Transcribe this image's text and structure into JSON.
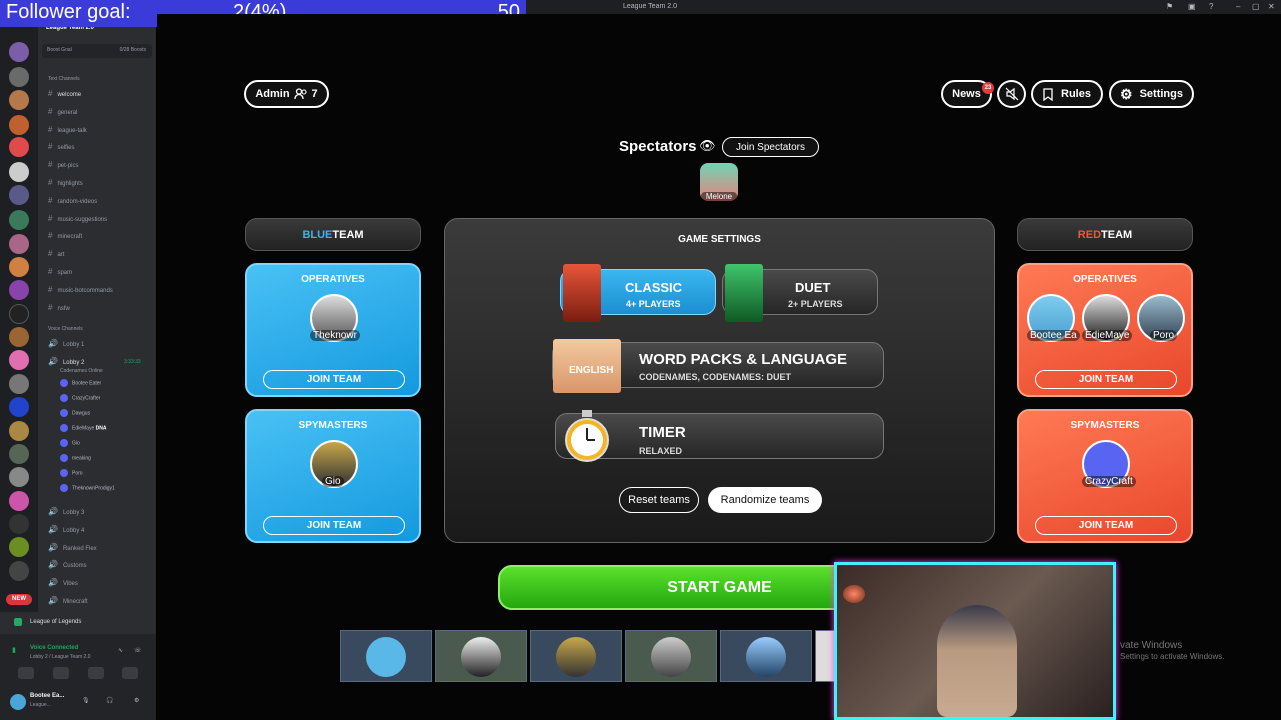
{
  "window": {
    "title": "League Team 2.0"
  },
  "overlay": {
    "label": "Follower goal:",
    "progress": "2(4%)",
    "goal": "50"
  },
  "discord": {
    "server_name": "League Team 2.0",
    "boost": {
      "label": "Boost Goal",
      "status": "0/28 Boosts"
    },
    "text_section": "Text Channels",
    "text_channels": [
      "welcome",
      "general",
      "league-talk",
      "selfies",
      "pet-pics",
      "highlights",
      "random-videos",
      "music-suggestions",
      "minecraft",
      "art",
      "spam",
      "music-botcommands",
      "nsfw"
    ],
    "voice_section": "Voice Channels",
    "lobby1": "Lobby 1",
    "lobby2": {
      "name": "Lobby 2",
      "time": "3:33:33",
      "activity": "Codenames Online"
    },
    "voice_users": [
      "Bootee Eater",
      "CrazyCrafter",
      "Dawgus",
      "EdieMaye",
      "Gio",
      "meaking",
      "Poro",
      "TheknownProdigy1"
    ],
    "voice_tag": "DNA",
    "other_channels": [
      "Lobby 3",
      "Lobby 4",
      "Ranked Flex",
      "Customs",
      "Vibes",
      "Minecraft"
    ],
    "new_badge": "NEW",
    "activity_game": "League of Legends",
    "voice_connected": "Voice Connected",
    "voice_location": "Lobby 2 / League Team 2.0",
    "user_name": "Bootee Ea...",
    "user_status": "League..."
  },
  "game": {
    "admin_label": "Admin",
    "player_count": "7",
    "news_label": "News",
    "news_badge": "23",
    "rules_label": "Rules",
    "settings_label": "Settings",
    "spectators_label": "Spectators",
    "join_spectators": "Join Spectators",
    "spectator_name": "Melone",
    "blue_team": {
      "prefix": "BLUE",
      "suffix": " TEAM",
      "operatives_label": "OPERATIVES",
      "operative": "Theknowr",
      "spymasters_label": "SPYMASTERS",
      "spymaster": "Gio",
      "join_label": "JOIN TEAM"
    },
    "red_team": {
      "prefix": "RED",
      "suffix": " TEAM",
      "operatives_label": "OPERATIVES",
      "operatives": [
        "Bootee Ea",
        "EdieMaye",
        "Poro"
      ],
      "spymasters_label": "SPYMASTERS",
      "spymaster": "CrazyCraft",
      "join_label": "JOIN TEAM"
    },
    "settings_title": "GAME SETTINGS",
    "classic": {
      "title": "CLASSIC",
      "sub": "4+ PLAYERS"
    },
    "duet": {
      "title": "DUET",
      "sub": "2+ PLAYERS"
    },
    "wordpacks": {
      "title": "WORD PACKS & LANGUAGE",
      "sub": "CODENAMES, CODENAMES: DUET",
      "tag": "ENGLISH"
    },
    "timer": {
      "title": "TIMER",
      "sub": "RELAXED"
    },
    "reset_label": "Reset teams",
    "randomize_label": "Randomize teams",
    "start_label": "START GAME"
  },
  "watermark": {
    "line1": "vate Windows",
    "line2": "Settings to activate Windows."
  },
  "colors": {
    "blue": "#2aa7ea",
    "red": "#f0573a",
    "green": "#3cc41c",
    "discord_bg": "#2b2d31"
  }
}
